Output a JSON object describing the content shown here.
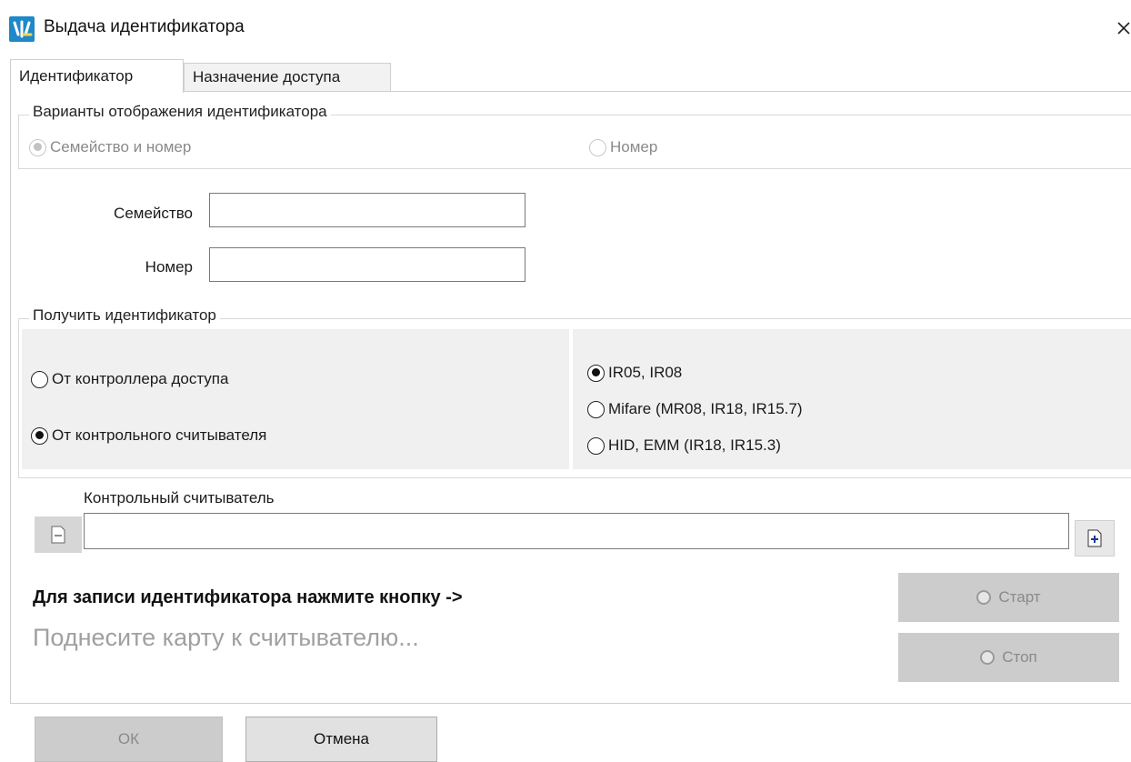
{
  "window": {
    "title": "Выдача идентификатора",
    "close_glyph": "×"
  },
  "tabs": [
    {
      "label": "Идентификатор",
      "active": true
    },
    {
      "label": "Назначение доступа",
      "active": false
    }
  ],
  "display_options": {
    "legend": "Варианты отображения идентификатора",
    "options": [
      {
        "label": "Семейство и номер",
        "checked": true,
        "disabled": true
      },
      {
        "label": "Номер",
        "checked": false,
        "disabled": true
      }
    ]
  },
  "fields": {
    "family_label": "Семейство",
    "family_value": "",
    "number_label": "Номер",
    "number_value": ""
  },
  "obtain": {
    "legend": "Получить идентификатор",
    "sources": [
      {
        "label": "От контроллера доступа",
        "checked": false
      },
      {
        "label": "От контрольного считывателя",
        "checked": true
      }
    ],
    "types": [
      {
        "label": "IR05, IR08",
        "checked": true
      },
      {
        "label": "Mifare (MR08, IR18, IR15.7)",
        "checked": false
      },
      {
        "label": "HID, EMM (IR18, IR15.3)",
        "checked": false
      }
    ]
  },
  "reader": {
    "label": "Контрольный считыватель",
    "value": ""
  },
  "instructions": {
    "main": "Для записи идентификатора нажмите кнопку ->",
    "status": "Поднесите карту к считывателю..."
  },
  "buttons": {
    "start": "Старт",
    "stop": "Стоп",
    "ok": "ОК",
    "cancel": "Отмена"
  },
  "colors": {
    "app_icon": "#1e88c8",
    "disabled_button": "#cccccc",
    "status_text": "#a0a0a0"
  }
}
